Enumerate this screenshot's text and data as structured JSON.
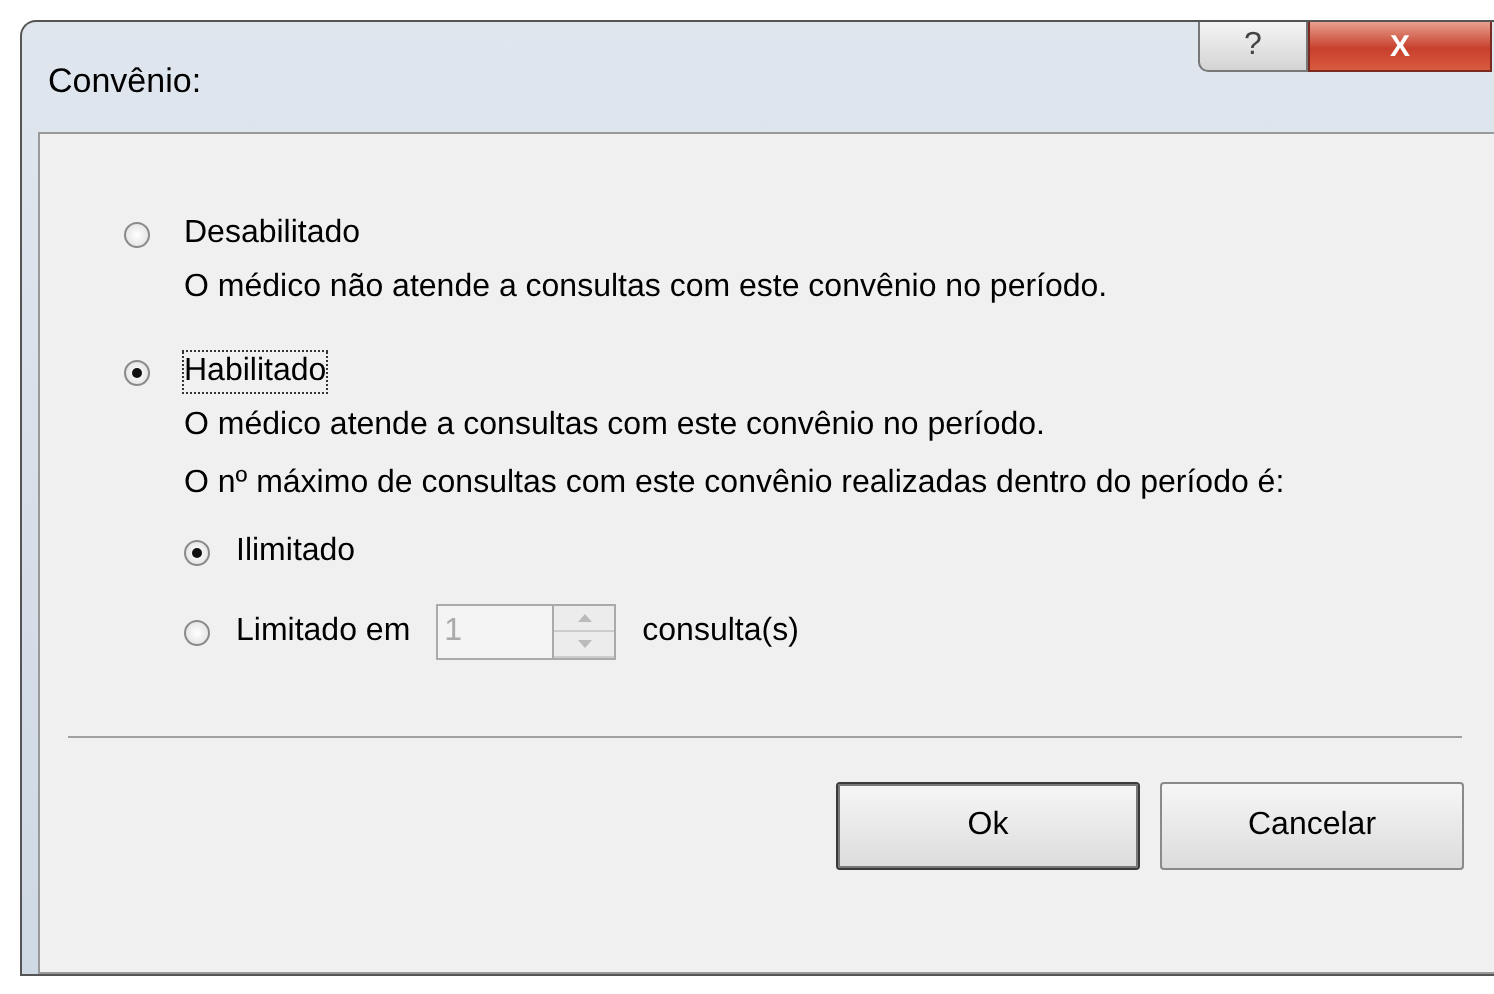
{
  "window": {
    "title": "Convênio:",
    "help_button": "?",
    "close_button": "X"
  },
  "options": [
    {
      "label": "Desabilitado",
      "selected": false,
      "focused": false,
      "description": [
        "O médico não atende a consultas com este convênio no período."
      ]
    },
    {
      "label": "Habilitado",
      "selected": true,
      "focused": true,
      "description": [
        "O médico atende a consultas com este convênio no período.",
        "O nº máximo de consultas com este convênio realizadas dentro do período é:"
      ]
    }
  ],
  "limit_options": [
    {
      "kind": "plain",
      "label": "Ilimitado",
      "selected": true
    },
    {
      "kind": "spin",
      "label": "Limitado em",
      "selected": false,
      "value": "1",
      "disabled": true,
      "suffix": "consulta(s)"
    }
  ],
  "buttons": [
    {
      "label": "Ok",
      "default": true
    },
    {
      "label": "Cancelar",
      "default": false
    }
  ]
}
